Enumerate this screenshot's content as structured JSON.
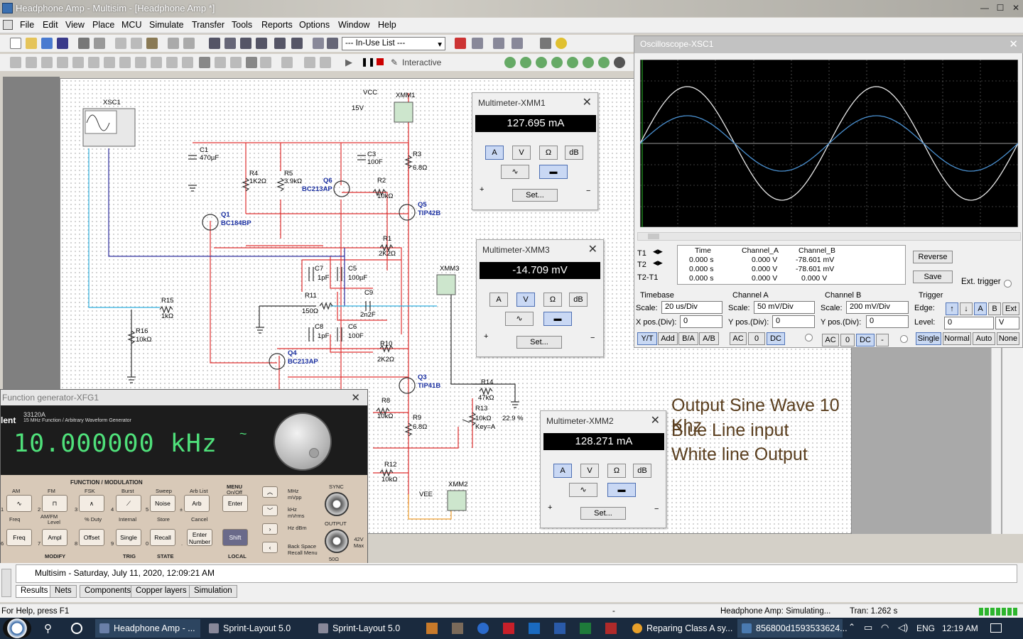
{
  "window": {
    "title": "Headphone Amp - Multisim - [Headphone Amp *]"
  },
  "menu": [
    "File",
    "Edit",
    "View",
    "Place",
    "MCU",
    "Simulate",
    "Transfer",
    "Tools",
    "Reports",
    "Options",
    "Window",
    "Help"
  ],
  "toolbar": {
    "in_use_list": "--- In-Use List ---",
    "interactive": "Interactive"
  },
  "components": {
    "xsc1": "XSC1",
    "vcc": "VCC",
    "vcc_val": "15V",
    "xmm1": "XMM1",
    "c1": "C1",
    "c1v": "470µF",
    "c3": "C3",
    "c3v": "100F",
    "r3": "R3",
    "r3v": "6.8Ω",
    "r4": "R4",
    "r4v": "1K2Ω",
    "r5": "R5",
    "r5v": "3.9kΩ",
    "q6": "Q6",
    "q6v": "BC213AP",
    "r2": "R2",
    "r2v": "10kΩ",
    "q5": "Q5",
    "q5v": "TIP42B",
    "q1": "Q1",
    "q1v": "BC184BP",
    "r1": "R1",
    "r1v": "2K2Ω",
    "c7": "C7",
    "c7v": "1pF",
    "c5": "C5",
    "c5v": "100µF",
    "xmm3": "XMM3",
    "r11": "R11",
    "r11v": "150Ω",
    "c9": "C9",
    "c9v": "2n2F",
    "r15": "R15",
    "r15v": "1kΩ",
    "r16": "R16",
    "r16v": "10kΩ",
    "c8": "C8",
    "c8v": "1pF",
    "c6": "C6",
    "c6v": "100F",
    "r10": "R10",
    "r10v": "2K2Ω",
    "q4": "Q4",
    "q4v": "BC213AP",
    "q3": "Q3",
    "q3v": "TIP41B",
    "r14": "R14",
    "r14v": "47kΩ",
    "r13": "R13",
    "r13v": "10kΩ",
    "r13k": "Key=A",
    "r13p": "22.9 %",
    "r8": "R8",
    "r8v": "10kΩ",
    "r9": "R9",
    "r9v": "6.8Ω",
    "r12": "R12",
    "r12v": "10kΩ",
    "vee": "VEE",
    "xmm2": "XMM2"
  },
  "annotation": {
    "line1": "Output Sine Wave 10 Khz",
    "line2": "Blue Line input",
    "line3": "White line Output"
  },
  "multimeters": [
    {
      "title": "Multimeter-XMM1",
      "value": "127.695 mA",
      "active": "A"
    },
    {
      "title": "Multimeter-XMM3",
      "value": "-14.709 mV",
      "active": "V"
    },
    {
      "title": "Multimeter-XMM2",
      "value": "128.271 mA",
      "active": "A"
    }
  ],
  "mm_buttons": {
    "a": "A",
    "v": "V",
    "ohm": "Ω",
    "db": "dB",
    "set": "Set...",
    "plus": "+",
    "minus": "−"
  },
  "oscilloscope": {
    "title": "Oscilloscope-XSC1",
    "readout": {
      "headers": [
        "Time",
        "Channel_A",
        "Channel_B"
      ],
      "rows": [
        {
          "label": "T1",
          "time": "0.000 s",
          "a": "0.000 V",
          "b": "-78.601 mV"
        },
        {
          "label": "T2",
          "time": "0.000 s",
          "a": "0.000 V",
          "b": "-78.601 mV"
        },
        {
          "label": "T2-T1",
          "time": "0.000 s",
          "a": "0.000 V",
          "b": "0.000 V"
        }
      ]
    },
    "reverse": "Reverse",
    "save": "Save",
    "ext_trigger": "Ext. trigger",
    "timebase": {
      "label": "Timebase",
      "scale_label": "Scale:",
      "scale": "20 us/Div",
      "xpos_label": "X pos.(Div):",
      "xpos": "0",
      "modes": [
        "Y/T",
        "Add",
        "B/A",
        "A/B"
      ]
    },
    "channel_a": {
      "label": "Channel A",
      "scale_label": "Scale:",
      "scale": "50 mV/Div",
      "ypos_label": "Y pos.(Div):",
      "ypos": "0",
      "coupling": [
        "AC",
        "0",
        "DC"
      ]
    },
    "channel_b": {
      "label": "Channel B",
      "scale_label": "Scale:",
      "scale": "200 mV/Div",
      "ypos_label": "Y pos.(Div):",
      "ypos": "0",
      "coupling": [
        "AC",
        "0",
        "DC",
        "-"
      ]
    },
    "trigger": {
      "label": "Trigger",
      "edge_label": "Edge:",
      "edge_opts": [
        "A",
        "B",
        "Ext"
      ],
      "level_label": "Level:",
      "level": "0",
      "level_unit": "V",
      "modes": [
        "Single",
        "Normal",
        "Auto",
        "None"
      ]
    }
  },
  "funcgen": {
    "title": "Function generator-XFG1",
    "brand": "lent",
    "model": "33120A",
    "subtitle": "15 MHz Function / Arbitrary Waveform Generator",
    "display": "10.000000 kHz",
    "display_wave": "~",
    "section": "FUNCTION / MODULATION",
    "top_labels": [
      "AM",
      "FM",
      "FSK",
      "Burst",
      "Sweep",
      "Arb List"
    ],
    "row1_keys": [
      "Noise",
      "Arb"
    ],
    "mid_labels": [
      "Freq",
      "Level",
      "% Duty",
      "Internal",
      "Store",
      "Cancel"
    ],
    "amfm": "AM/FM",
    "row2_keys": [
      "Freq",
      "Ampl",
      "Offset",
      "Single",
      "Recall",
      "Enter Number"
    ],
    "nums": [
      "1",
      "2",
      "3",
      "4",
      "5",
      "±",
      "6",
      "7",
      "8",
      "9",
      "0",
      "."
    ],
    "bottom_labels": [
      "MODIFY",
      "TRIG",
      "STATE",
      "LOCAL"
    ],
    "menu": "MENU",
    "menu_sub": "On/Off",
    "enter": "Enter",
    "shift": "Shift",
    "units": [
      "MHz mVpp",
      "kHz mVrms",
      "Hz dBm",
      "Back Space Recall Menu"
    ],
    "sync": "SYNC",
    "output": "OUTPUT",
    "max": "42V Max",
    "ohm": "50Ω"
  },
  "statusbar": {
    "log": "Multisim  -  Saturday, July 11, 2020, 12:09:21 AM",
    "tabs": [
      "Results",
      "Nets",
      "Components",
      "Copper layers",
      "Simulation"
    ],
    "help": "For Help, press F1",
    "dash": "-",
    "sim": "Headphone Amp: Simulating...",
    "tran": "Tran: 1.262 s"
  },
  "taskbar": {
    "items": [
      "Headphone Amp - ...",
      "Sprint-Layout 5.0",
      "Sprint-Layout 5.0",
      "Reparing Class A sy...",
      "856800d1593533624..."
    ],
    "lang": "ENG",
    "time": "12:19 AM"
  }
}
